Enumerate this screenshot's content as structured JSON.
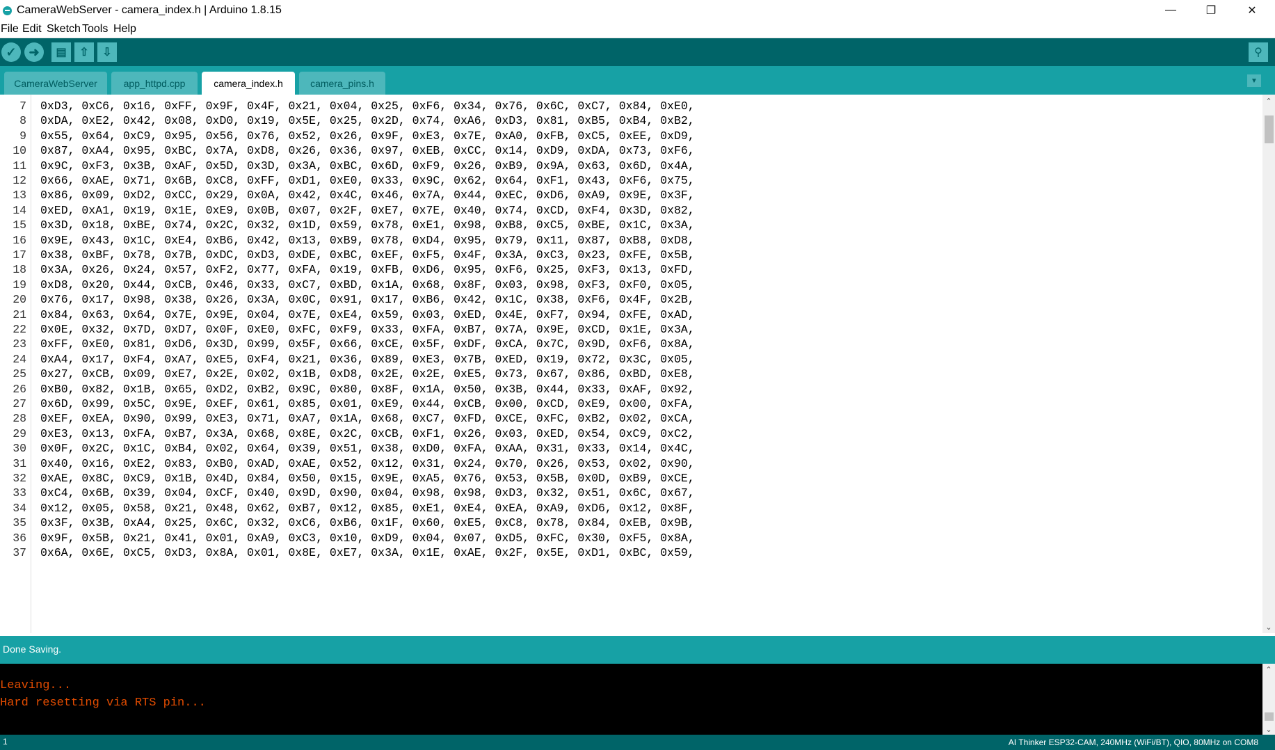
{
  "window": {
    "title": "CameraWebServer - camera_index.h | Arduino 1.8.15",
    "minimize_label": "—",
    "restore_label": "❐",
    "close_label": "✕"
  },
  "menu": {
    "items": [
      "File",
      "Edit",
      "Sketch",
      "Tools",
      "Help"
    ]
  },
  "toolbar": {
    "verify_icon": "✓",
    "upload_icon": "➜",
    "new_icon": "▤",
    "open_icon": "⇧",
    "save_icon": "⇩",
    "serial_monitor_icon": "⚲"
  },
  "tabs": [
    {
      "label": "CameraWebServer",
      "active": false
    },
    {
      "label": "app_httpd.cpp",
      "active": false
    },
    {
      "label": "camera_index.h",
      "active": true
    },
    {
      "label": "camera_pins.h",
      "active": false
    }
  ],
  "tab_menu_icon": "▼",
  "editor": {
    "lines": [
      {
        "num": "7",
        "text": "0xD3, 0xC6, 0x16, 0xFF, 0x9F, 0x4F, 0x21, 0x04, 0x25, 0xF6, 0x34, 0x76, 0x6C, 0xC7, 0x84, 0xE0,"
      },
      {
        "num": "8",
        "text": "0xDA, 0xE2, 0x42, 0x08, 0xD0, 0x19, 0x5E, 0x25, 0x2D, 0x74, 0xA6, 0xD3, 0x81, 0xB5, 0xB4, 0xB2,"
      },
      {
        "num": "9",
        "text": "0x55, 0x64, 0xC9, 0x95, 0x56, 0x76, 0x52, 0x26, 0x9F, 0xE3, 0x7E, 0xA0, 0xFB, 0xC5, 0xEE, 0xD9,"
      },
      {
        "num": "10",
        "text": "0x87, 0xA4, 0x95, 0xBC, 0x7A, 0xD8, 0x26, 0x36, 0x97, 0xEB, 0xCC, 0x14, 0xD9, 0xDA, 0x73, 0xF6,"
      },
      {
        "num": "11",
        "text": "0x9C, 0xF3, 0x3B, 0xAF, 0x5D, 0x3D, 0x3A, 0xBC, 0x6D, 0xF9, 0x26, 0xB9, 0x9A, 0x63, 0x6D, 0x4A,"
      },
      {
        "num": "12",
        "text": "0x66, 0xAE, 0x71, 0x6B, 0xC8, 0xFF, 0xD1, 0xE0, 0x33, 0x9C, 0x62, 0x64, 0xF1, 0x43, 0xF6, 0x75,"
      },
      {
        "num": "13",
        "text": "0x86, 0x09, 0xD2, 0xCC, 0x29, 0x0A, 0x42, 0x4C, 0x46, 0x7A, 0x44, 0xEC, 0xD6, 0xA9, 0x9E, 0x3F,"
      },
      {
        "num": "14",
        "text": "0xED, 0xA1, 0x19, 0x1E, 0xE9, 0x0B, 0x07, 0x2F, 0xE7, 0x7E, 0x40, 0x74, 0xCD, 0xF4, 0x3D, 0x82,"
      },
      {
        "num": "15",
        "text": "0x3D, 0x18, 0xBE, 0x74, 0x2C, 0x32, 0x1D, 0x59, 0x78, 0xE1, 0x98, 0xB8, 0xC5, 0xBE, 0x1C, 0x3A,"
      },
      {
        "num": "16",
        "text": "0x9E, 0x43, 0x1C, 0xE4, 0xB6, 0x42, 0x13, 0xB9, 0x78, 0xD4, 0x95, 0x79, 0x11, 0x87, 0xB8, 0xD8,"
      },
      {
        "num": "17",
        "text": "0x38, 0xBF, 0x78, 0x7B, 0xDC, 0xD3, 0xDE, 0xBC, 0xEF, 0xF5, 0x4F, 0x3A, 0xC3, 0x23, 0xFE, 0x5B,"
      },
      {
        "num": "18",
        "text": "0x3A, 0x26, 0x24, 0x57, 0xF2, 0x77, 0xFA, 0x19, 0xFB, 0xD6, 0x95, 0xF6, 0x25, 0xF3, 0x13, 0xFD,"
      },
      {
        "num": "19",
        "text": "0xD8, 0x20, 0x44, 0xCB, 0x46, 0x33, 0xC7, 0xBD, 0x1A, 0x68, 0x8F, 0x03, 0x98, 0xF3, 0xF0, 0x05,"
      },
      {
        "num": "20",
        "text": "0x76, 0x17, 0x98, 0x38, 0x26, 0x3A, 0x0C, 0x91, 0x17, 0xB6, 0x42, 0x1C, 0x38, 0xF6, 0x4F, 0x2B,"
      },
      {
        "num": "21",
        "text": "0x84, 0x63, 0x64, 0x7E, 0x9E, 0x04, 0x7E, 0xE4, 0x59, 0x03, 0xED, 0x4E, 0xF7, 0x94, 0xFE, 0xAD,"
      },
      {
        "num": "22",
        "text": "0x0E, 0x32, 0x7D, 0xD7, 0x0F, 0xE0, 0xFC, 0xF9, 0x33, 0xFA, 0xB7, 0x7A, 0x9E, 0xCD, 0x1E, 0x3A,"
      },
      {
        "num": "23",
        "text": "0xFF, 0xE0, 0x81, 0xD6, 0x3D, 0x99, 0x5F, 0x66, 0xCE, 0x5F, 0xDF, 0xCA, 0x7C, 0x9D, 0xF6, 0x8A,"
      },
      {
        "num": "24",
        "text": "0xA4, 0x17, 0xF4, 0xA7, 0xE5, 0xF4, 0x21, 0x36, 0x89, 0xE3, 0x7B, 0xED, 0x19, 0x72, 0x3C, 0x05,"
      },
      {
        "num": "25",
        "text": "0x27, 0xCB, 0x09, 0xE7, 0x2E, 0x02, 0x1B, 0xD8, 0x2E, 0x2E, 0xE5, 0x73, 0x67, 0x86, 0xBD, 0xE8,"
      },
      {
        "num": "26",
        "text": "0xB0, 0x82, 0x1B, 0x65, 0xD2, 0xB2, 0x9C, 0x80, 0x8F, 0x1A, 0x50, 0x3B, 0x44, 0x33, 0xAF, 0x92,"
      },
      {
        "num": "27",
        "text": "0x6D, 0x99, 0x5C, 0x9E, 0xEF, 0x61, 0x85, 0x01, 0xE9, 0x44, 0xCB, 0x00, 0xCD, 0xE9, 0x00, 0xFA,"
      },
      {
        "num": "28",
        "text": "0xEF, 0xEA, 0x90, 0x99, 0xE3, 0x71, 0xA7, 0x1A, 0x68, 0xC7, 0xFD, 0xCE, 0xFC, 0xB2, 0x02, 0xCA,"
      },
      {
        "num": "29",
        "text": "0xE3, 0x13, 0xFA, 0xB7, 0x3A, 0x68, 0x8E, 0x2C, 0xCB, 0xF1, 0x26, 0x03, 0xED, 0x54, 0xC9, 0xC2,"
      },
      {
        "num": "30",
        "text": "0x0F, 0x2C, 0x1C, 0xB4, 0x02, 0x64, 0x39, 0x51, 0x38, 0xD0, 0xFA, 0xAA, 0x31, 0x33, 0x14, 0x4C,"
      },
      {
        "num": "31",
        "text": "0x40, 0x16, 0xE2, 0x83, 0xB0, 0xAD, 0xAE, 0x52, 0x12, 0x31, 0x24, 0x70, 0x26, 0x53, 0x02, 0x90,"
      },
      {
        "num": "32",
        "text": "0xAE, 0x8C, 0xC9, 0x1B, 0x4D, 0x84, 0x50, 0x15, 0x9E, 0xA5, 0x76, 0x53, 0x5B, 0x0D, 0xB9, 0xCE,"
      },
      {
        "num": "33",
        "text": "0xC4, 0x6B, 0x39, 0x04, 0xCF, 0x40, 0x9D, 0x90, 0x04, 0x98, 0x98, 0xD3, 0x32, 0x51, 0x6C, 0x67,"
      },
      {
        "num": "34",
        "text": "0x12, 0x05, 0x58, 0x21, 0x48, 0x62, 0xB7, 0x12, 0x85, 0xE1, 0xE4, 0xEA, 0xA9, 0xD6, 0x12, 0x8F,"
      },
      {
        "num": "35",
        "text": "0x3F, 0x3B, 0xA4, 0x25, 0x6C, 0x32, 0xC6, 0xB6, 0x1F, 0x60, 0xE5, 0xC8, 0x78, 0x84, 0xEB, 0x9B,"
      },
      {
        "num": "36",
        "text": "0x9F, 0x5B, 0x21, 0x41, 0x01, 0xA9, 0xC3, 0x10, 0xD9, 0x04, 0x07, 0xD5, 0xFC, 0x30, 0xF5, 0x8A,"
      },
      {
        "num": "37",
        "text": "0x6A, 0x6E, 0xC5, 0xD3, 0x8A, 0x01, 0x8E, 0xE7, 0x3A, 0x1E, 0xAE, 0x2F, 0x5E, 0xD1, 0xBC, 0x59,"
      }
    ],
    "scroll_up_icon": "⌃",
    "scroll_down_icon": "⌄"
  },
  "status": {
    "message": "Done Saving."
  },
  "console": {
    "lines": [
      "Leaving...",
      "Hard resetting via RTS pin..."
    ],
    "text_color": "#e34c00"
  },
  "footer": {
    "line_number": "1",
    "board_info": "AI Thinker ESP32-CAM, 240MHz (WiFi/BT), QIO, 80MHz on COM8"
  },
  "colors": {
    "toolbar": "#006468",
    "tabbar": "#17a1a5",
    "button": "#4db7bb"
  }
}
